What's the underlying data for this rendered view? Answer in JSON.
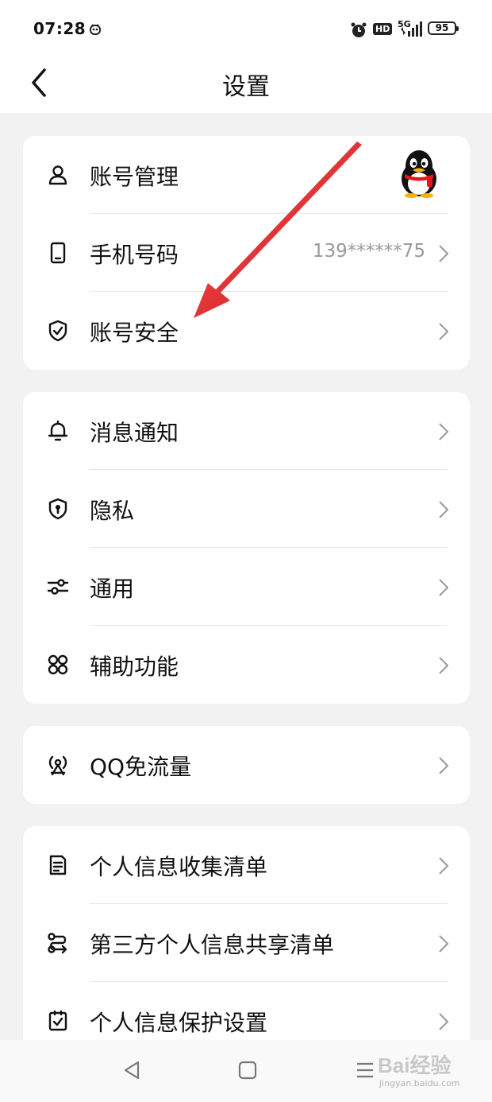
{
  "status_bar": {
    "time": "07:28",
    "network": "5G",
    "hd": "HD",
    "battery": "95"
  },
  "header": {
    "title": "设置"
  },
  "sections": [
    {
      "items": [
        {
          "label": "账号管理",
          "icon": "person-icon",
          "trailing": "avatar"
        },
        {
          "label": "手机号码",
          "icon": "phone-icon",
          "value": "139******75"
        },
        {
          "label": "账号安全",
          "icon": "shield-check-icon"
        }
      ]
    },
    {
      "items": [
        {
          "label": "消息通知",
          "icon": "bell-icon"
        },
        {
          "label": "隐私",
          "icon": "privacy-shield-icon"
        },
        {
          "label": "通用",
          "icon": "sliders-icon"
        },
        {
          "label": "辅助功能",
          "icon": "grid-icon"
        }
      ]
    },
    {
      "items": [
        {
          "label": "QQ免流量",
          "icon": "signal-tower-icon"
        }
      ]
    },
    {
      "items": [
        {
          "label": "个人信息收集清单",
          "icon": "document-icon"
        },
        {
          "label": "第三方个人信息共享清单",
          "icon": "share-icon"
        },
        {
          "label": "个人信息保护设置",
          "icon": "checkbox-icon"
        }
      ]
    }
  ],
  "watermark": {
    "brand": "Bai经验",
    "url": "jingyan.baidu.com"
  },
  "colors": {
    "accent_arrow": "#e8161b",
    "background": "#f2f2f2",
    "card": "#ffffff"
  }
}
